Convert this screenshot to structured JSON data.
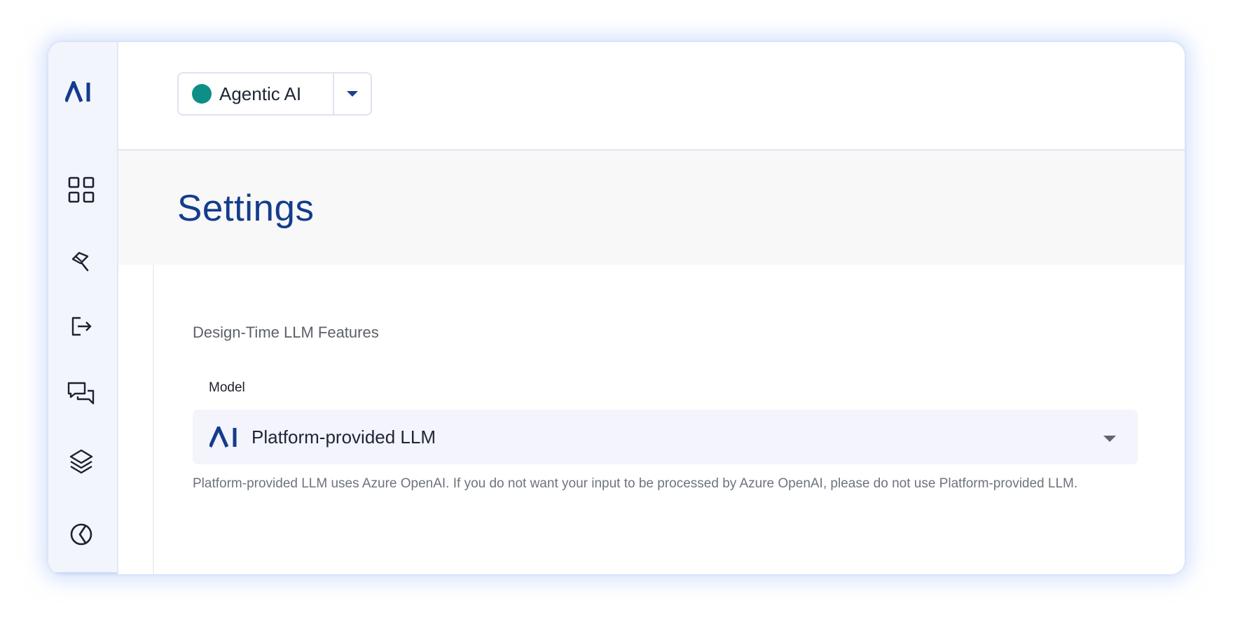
{
  "workspace": {
    "name": "Agentic AI",
    "status_color": "#0e8f86"
  },
  "sidebar": {
    "logo_icon": "ai-logo-icon",
    "items": [
      {
        "icon": "grid-icon"
      },
      {
        "icon": "tools-icon"
      },
      {
        "icon": "sign-out-arrow-icon"
      },
      {
        "icon": "chat-bubbles-icon"
      },
      {
        "icon": "layers-icon"
      },
      {
        "icon": "pie-chart-icon"
      }
    ]
  },
  "page": {
    "title": "Settings"
  },
  "settings": {
    "section_title": "Design-Time LLM Features",
    "model_label": "Model",
    "model_value": "Platform-provided LLM",
    "model_icon": "ai-logo-icon",
    "helper_text": "Platform-provided LLM uses Azure OpenAI. If you do not want your input to be processed by Azure OpenAI, please do not use Platform-provided LLM."
  },
  "colors": {
    "brand": "#153c8c",
    "accent": "#0e8f86"
  }
}
